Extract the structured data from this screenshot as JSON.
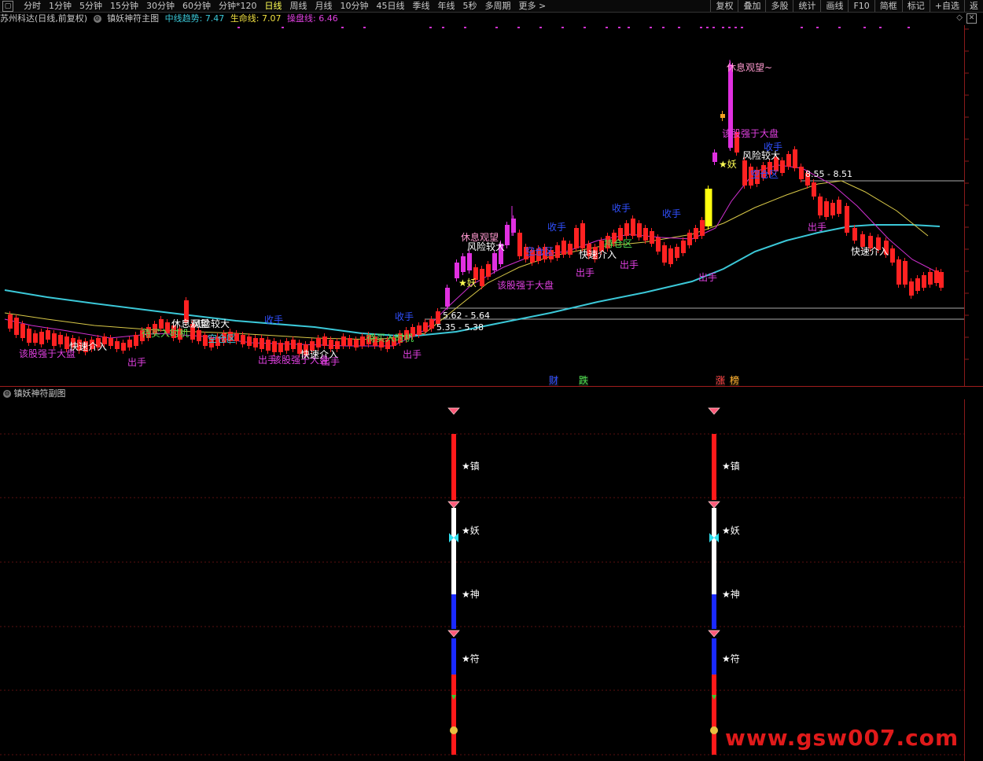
{
  "topbar": {
    "tabs": [
      "分时",
      "1分钟",
      "5分钟",
      "15分钟",
      "30分钟",
      "60分钟",
      "分钟*120",
      "日线",
      "周线",
      "月线",
      "10分钟",
      "45日线",
      "季线",
      "年线",
      "5秒",
      "多周期",
      "更多"
    ],
    "active_tab": "日线",
    "tools": [
      "复权",
      "叠加",
      "多股",
      "统计",
      "画线",
      "F10",
      "简框",
      "标记",
      "+自选",
      "返"
    ]
  },
  "main_panel": {
    "stock": "苏州科达(日线,前复权)",
    "indicator": "镇妖神符主图",
    "mid_trend_label": "中线趋势:",
    "mid_trend_value": "7.47",
    "life_line_label": "生命线:",
    "life_line_value": "7.07",
    "op_line_label": "操盘线:",
    "op_line_value": "6.46",
    "price_box_1": "5.62 - 5.64",
    "price_box_2": "5.35 - 5.38",
    "price_box_3": "8.55 - 8.51"
  },
  "annotations": {
    "rest_watch": "休息观望",
    "rest_watch_2": "休息观望~",
    "high_risk": "风险较大",
    "stronger_than_market": "该股强于大盘",
    "quick_entry": "快速介入",
    "quick_entry_2": "快速介入",
    "sell": "出手",
    "collect": "收手",
    "empty_zone": "空仓区",
    "hold_zone": "持仓区",
    "wait_entry": "待买入时机",
    "demon": "★妖",
    "cai": "财",
    "die": "跌",
    "zhang": "涨",
    "bang": "榜"
  },
  "sub_panel": {
    "indicator": "镇妖神符副图",
    "labels": [
      "★镇",
      "★妖",
      "★神",
      "★符"
    ]
  },
  "watermark": "www.gsw007.com",
  "colors": {
    "up": "#ff2020",
    "cyan_line": "#3bc8d8",
    "yellow_line": "#d8c848",
    "magenta_line": "#d030d0",
    "blue_text": "#3050ff",
    "magenta_text": "#e040e0"
  }
}
